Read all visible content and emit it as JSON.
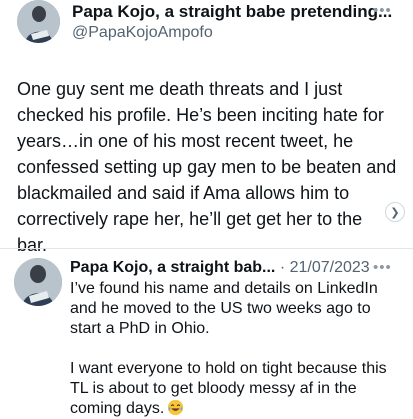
{
  "tweet": {
    "display_name": "Papa Kojo, a straight babe pretending...",
    "handle": "@PapaKojoAmpofo",
    "more_icon": "more-horizontal-icon",
    "text": "One guy sent me death threats and I just checked his profile. He’s been inciting hate for years…in one of his most recent tweet, he confessed setting up gay men to be beaten and blackmailed and said if Ama allows him to correctively rape her, he’ll get get her to the bar."
  },
  "reply": {
    "display_name": "Papa Kojo, a straight bab...",
    "separator": " · ",
    "date": "21/07/2023",
    "more_icon": "more-horizontal-icon",
    "paragraph1": "I’ve found his name and details on LinkedIn and he moved to the US two weeks ago to start a PhD in Ohio.",
    "paragraph2": "I want everyone to hold on tight because this TL is about to get bloody messy af in the coming days.",
    "emoji": "tears-of-joy-emoji"
  },
  "colors": {
    "text": "#0f1419",
    "secondary": "#536471",
    "divider": "#e1e6ea"
  }
}
